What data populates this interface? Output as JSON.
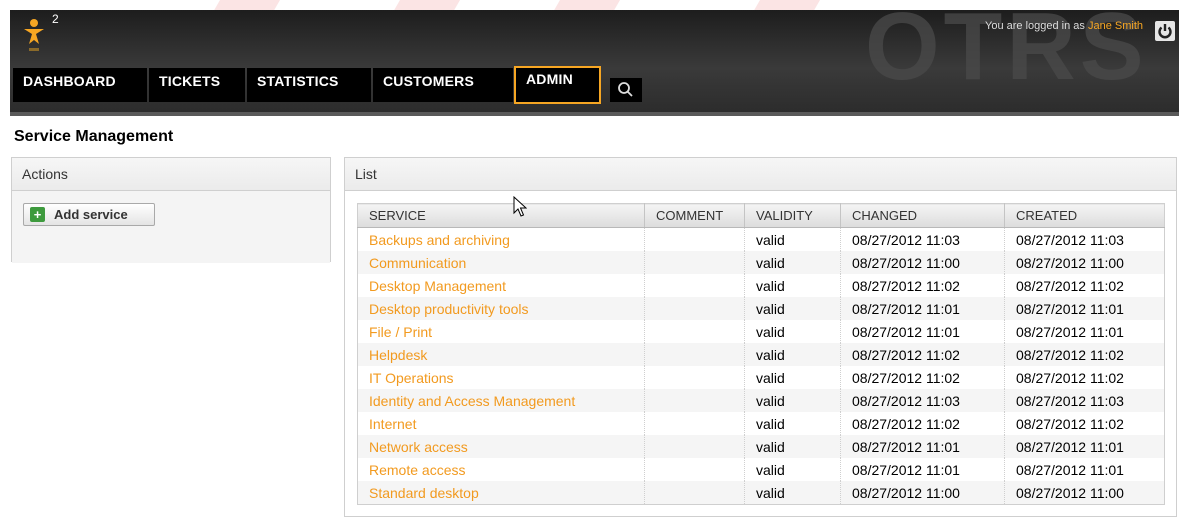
{
  "header": {
    "notification_count": "2",
    "logo_text": "OTRS",
    "login_prefix": "You are logged in as",
    "user_name": "Jane Smith",
    "nav": [
      "DASHBOARD",
      "TICKETS",
      "STATISTICS",
      "CUSTOMERS",
      "ADMIN"
    ],
    "active_nav": "ADMIN"
  },
  "page_title": "Service Management",
  "actions": {
    "title": "Actions",
    "add_button_label": "Add service"
  },
  "list": {
    "title": "List",
    "columns": [
      "SERVICE",
      "COMMENT",
      "VALIDITY",
      "CHANGED",
      "CREATED"
    ],
    "rows": [
      {
        "service": "Backups and archiving",
        "comment": "",
        "validity": "valid",
        "changed": "08/27/2012 11:03",
        "created": "08/27/2012 11:03"
      },
      {
        "service": "Communication",
        "comment": "",
        "validity": "valid",
        "changed": "08/27/2012 11:00",
        "created": "08/27/2012 11:00"
      },
      {
        "service": "Desktop Management",
        "comment": "",
        "validity": "valid",
        "changed": "08/27/2012 11:02",
        "created": "08/27/2012 11:02"
      },
      {
        "service": "Desktop productivity tools",
        "comment": "",
        "validity": "valid",
        "changed": "08/27/2012 11:01",
        "created": "08/27/2012 11:01"
      },
      {
        "service": "File / Print",
        "comment": "",
        "validity": "valid",
        "changed": "08/27/2012 11:01",
        "created": "08/27/2012 11:01"
      },
      {
        "service": "Helpdesk",
        "comment": "",
        "validity": "valid",
        "changed": "08/27/2012 11:02",
        "created": "08/27/2012 11:02"
      },
      {
        "service": "IT Operations",
        "comment": "",
        "validity": "valid",
        "changed": "08/27/2012 11:02",
        "created": "08/27/2012 11:02"
      },
      {
        "service": "Identity and Access Management",
        "comment": "",
        "validity": "valid",
        "changed": "08/27/2012 11:03",
        "created": "08/27/2012 11:03"
      },
      {
        "service": "Internet",
        "comment": "",
        "validity": "valid",
        "changed": "08/27/2012 11:02",
        "created": "08/27/2012 11:02"
      },
      {
        "service": "Network access",
        "comment": "",
        "validity": "valid",
        "changed": "08/27/2012 11:01",
        "created": "08/27/2012 11:01"
      },
      {
        "service": "Remote access",
        "comment": "",
        "validity": "valid",
        "changed": "08/27/2012 11:01",
        "created": "08/27/2012 11:01"
      },
      {
        "service": "Standard desktop",
        "comment": "",
        "validity": "valid",
        "changed": "08/27/2012 11:00",
        "created": "08/27/2012 11:00"
      }
    ]
  },
  "colors": {
    "accent": "#f6a623",
    "link": "#f29a1f",
    "header_bg": "#2b2b2b",
    "add_icon": "#3d9a3d"
  },
  "icons": {
    "avatar": "agent-avatar-icon",
    "logout": "power-icon",
    "search": "search-icon",
    "add": "plus-icon"
  }
}
